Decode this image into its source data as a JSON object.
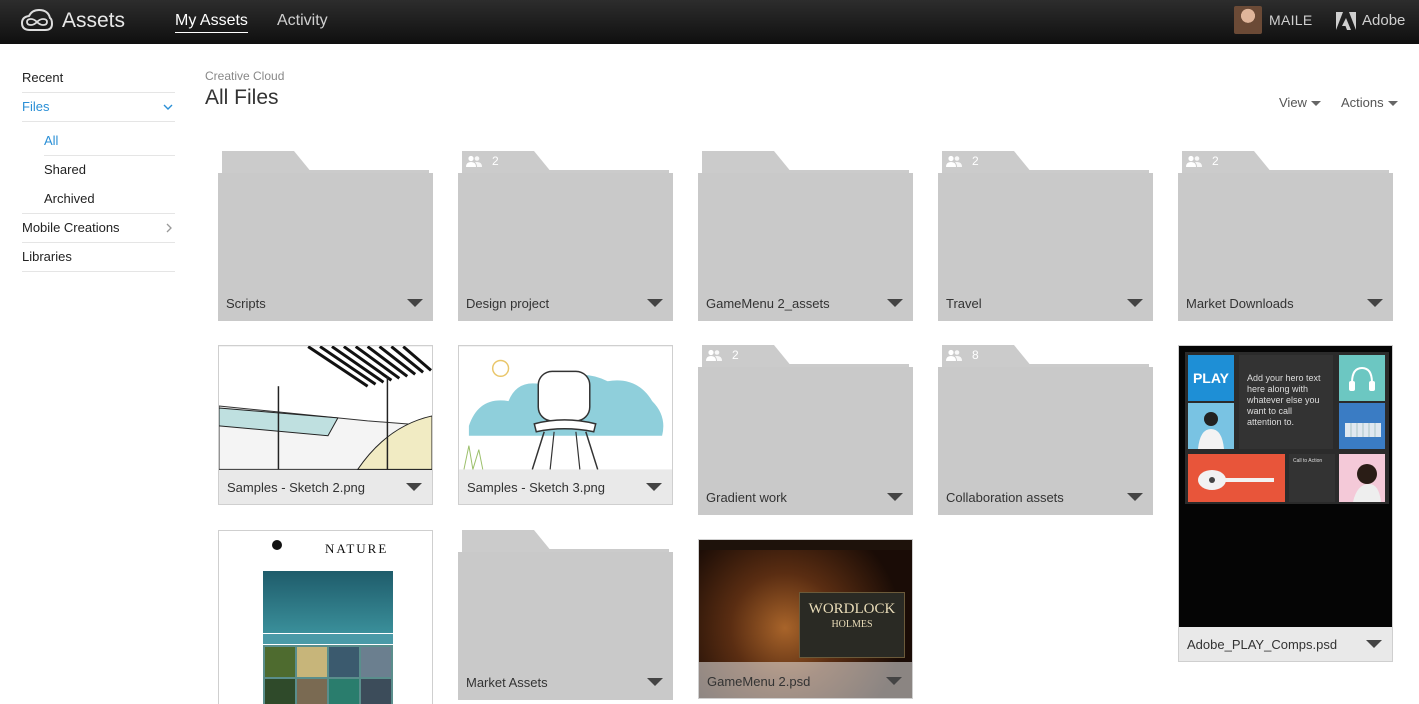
{
  "app": {
    "title": "Assets"
  },
  "nav": {
    "tabs": [
      "My Assets",
      "Activity"
    ],
    "active": "My Assets"
  },
  "user": {
    "name": "MAILE",
    "brand": "Adobe"
  },
  "sidebar": {
    "items": [
      {
        "label": "Recent"
      },
      {
        "label": "Files",
        "expanded": true,
        "children": [
          {
            "label": "All",
            "selected": true
          },
          {
            "label": "Shared"
          },
          {
            "label": "Archived"
          }
        ]
      },
      {
        "label": "Mobile Creations"
      },
      {
        "label": "Libraries"
      }
    ]
  },
  "header": {
    "breadcrumb": "Creative Cloud",
    "title": "All Files",
    "view_label": "View",
    "actions_label": "Actions"
  },
  "folders": [
    {
      "name": "Scripts",
      "shared": ""
    },
    {
      "name": "Design project",
      "shared": "2"
    },
    {
      "name": "GameMenu 2_assets",
      "shared": ""
    },
    {
      "name": "Travel",
      "shared": "2"
    },
    {
      "name": "Market Downloads",
      "shared": "2"
    },
    {
      "name": "Gradient work",
      "shared": "2"
    },
    {
      "name": "Collaboration assets",
      "shared": "8"
    },
    {
      "name": "Market Assets",
      "shared": ""
    }
  ],
  "files": [
    {
      "name": "Samples - Sketch 2.png"
    },
    {
      "name": "Samples - Sketch 3.png"
    },
    {
      "name": "Adobe_PLAY_Comps.psd",
      "thumb_text": {
        "play": "PLAY",
        "hero": "Add your hero text here along with whatever else you want to call attention to.",
        "cta": "Call to Action"
      }
    },
    {
      "name": "",
      "thumb_text": {
        "title": "NATURE"
      }
    },
    {
      "name": "GameMenu 2.psd",
      "thumb_text": {
        "title": "WORDLOCK",
        "subtitle": "HOLMES"
      }
    }
  ],
  "colors": {
    "accent": "#2a8fd6",
    "folder": "#c9c9c9",
    "topbar": "#1a1a1a",
    "play_orange": "#e8553a",
    "play_blue": "#1e8fd6"
  }
}
